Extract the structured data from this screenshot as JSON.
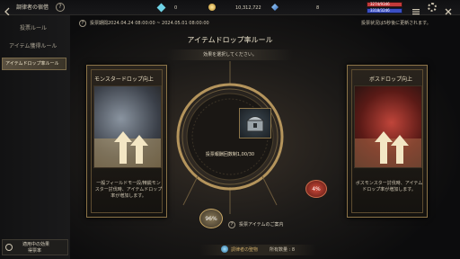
{
  "header": {
    "title": "調律者の宿借",
    "currencies": [
      {
        "icon": "gem-icon",
        "value": "0"
      },
      {
        "icon": "gold-coin-icon",
        "value": "10,312,722"
      },
      {
        "icon": "crystal-icon",
        "value": "8"
      }
    ],
    "hp_text": "3274/9346",
    "mp_text": "3318/3246"
  },
  "sidebar": {
    "items": [
      {
        "label": "投票ルール"
      },
      {
        "label": "アイテム獲得ルール"
      },
      {
        "label": "アイテムドロップ率ルール"
      }
    ],
    "bottom_button": {
      "line1": "適用中の効果",
      "line2": "得票率"
    }
  },
  "info": {
    "period": "投票期間2024.04.24 08:00:00 ~ 2024.05.01 08:00:00",
    "note": "投票状況は5秒後に更新されます。"
  },
  "main": {
    "title": "アイテムドロップ率ルール",
    "subtitle": "効果を選択してください。",
    "center_label": "投票報酬回数制1,00/30",
    "left_percent": "96%",
    "right_percent": "4%",
    "guide_text": "投票アイテムのご案内",
    "footer_item": "調律者の聖物",
    "footer_count": "所有数量 : 8"
  },
  "cards": [
    {
      "title": "モンスタードロップ向上",
      "desc": "一般フィールドモー段/精鋭モンスター討伐時、アイテムドロップ率が増加します。"
    },
    {
      "title": "ボスドロップ向上",
      "desc": "ボスモンスター討伐時、アイテムドロップ率が増加します。"
    }
  ],
  "colors": {
    "gold": "#c9a866",
    "hp": "#c23a3a",
    "mp": "#3b4fc4",
    "selected": "#5a5040"
  }
}
